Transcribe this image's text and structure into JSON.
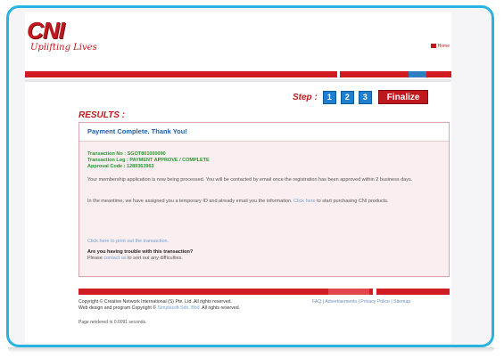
{
  "header": {
    "logo_text": "CNI",
    "logo_sub": "Uplifting Lives",
    "home_label": "Home"
  },
  "steps": {
    "label": "Step :",
    "items": [
      "1",
      "2",
      "3"
    ],
    "finalize_label": "Finalize"
  },
  "results": {
    "title": "RESULTS :",
    "heading": "Payment Complete. Thank You!",
    "transaction_no": "Transaction No : SGOT801000090",
    "transaction_log": "Transaction Log : PAYMENT APPROVE / COMPLETE",
    "approval_code": "Approval Code : 1289363963",
    "message1": "Your membership application is now being processed. You will be contacted by email once the registration has been approved within 2 business days.",
    "message2_pre": "In the meantime, we have assigned you a temporary ID and already email you the information.",
    "message2_link": "Click here",
    "message2_post": "to start purchasing CNI products.",
    "print_link": "Click here to print out the transaction.",
    "trouble_heading": "Are you having trouble with this transaction?",
    "trouble_pre": "Please",
    "trouble_link": "contact us",
    "trouble_post": "to sort out any difficulties."
  },
  "footer": {
    "copyright1": "Copyright © Creative Network International (S) Pte. Ltd. All rights reserved.",
    "copyright2_pre": "Web design and program Copyright ©",
    "copyright2_link": "Simplesoft Sdn. Bhd.",
    "copyright2_post": "All rights reserved.",
    "links": "FAQ | Advertisements | Privacy Police | Sitemap",
    "rendered": "Page rendered in 0.0091 seconds."
  },
  "colors": {
    "accent_red": "#c0181f",
    "step_blue": "#1f7fcf",
    "frame_blue": "#29b3e3",
    "success_green": "#1f9a2f"
  }
}
